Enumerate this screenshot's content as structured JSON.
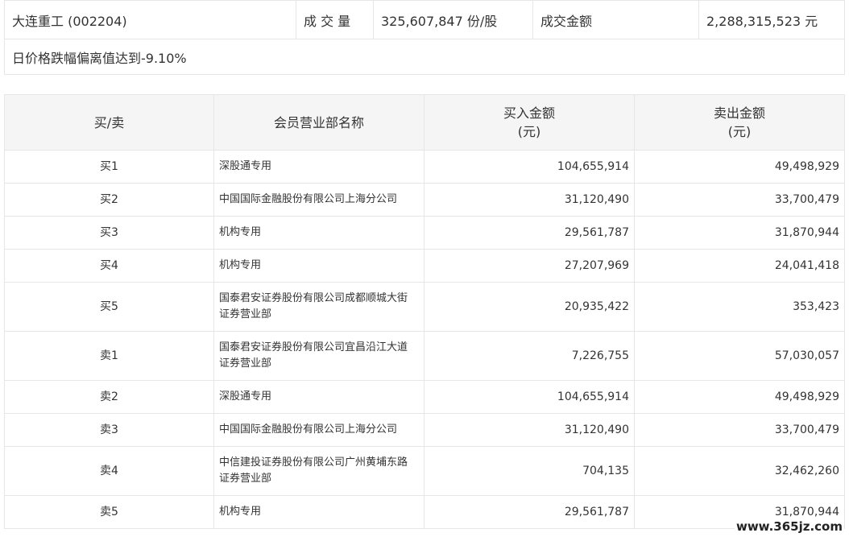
{
  "summary": {
    "stock": "大连重工 (002204)",
    "volume_label": "成 交 量",
    "volume_value": "325,607,847 份/股",
    "amount_label": "成交金额",
    "amount_value": "2,288,315,523 元",
    "note": "日价格跌幅偏离值达到-9.10%"
  },
  "table": {
    "headers": {
      "side": "买/卖",
      "name": "会员营业部名称",
      "buy": "买入金额\n(元)",
      "sell": "卖出金额\n(元)"
    },
    "rows": [
      {
        "side": "买1",
        "name": "深股通专用",
        "buy": "104,655,914",
        "sell": "49,498,929"
      },
      {
        "side": "买2",
        "name": "中国国际金融股份有限公司上海分公司",
        "buy": "31,120,490",
        "sell": "33,700,479"
      },
      {
        "side": "买3",
        "name": "机构专用",
        "buy": "29,561,787",
        "sell": "31,870,944"
      },
      {
        "side": "买4",
        "name": "机构专用",
        "buy": "27,207,969",
        "sell": "24,041,418"
      },
      {
        "side": "买5",
        "name": "国泰君安证券股份有限公司成都顺城大街证券营业部",
        "buy": "20,935,422",
        "sell": "353,423"
      },
      {
        "side": "卖1",
        "name": "国泰君安证券股份有限公司宜昌沿江大道证券营业部",
        "buy": "7,226,755",
        "sell": "57,030,057"
      },
      {
        "side": "卖2",
        "name": "深股通专用",
        "buy": "104,655,914",
        "sell": "49,498,929"
      },
      {
        "side": "卖3",
        "name": "中国国际金融股份有限公司上海分公司",
        "buy": "31,120,490",
        "sell": "33,700,479"
      },
      {
        "side": "卖4",
        "name": "中信建投证券股份有限公司广州黄埔东路证券营业部",
        "buy": "704,135",
        "sell": "32,462,260"
      },
      {
        "side": "卖5",
        "name": "机构专用",
        "buy": "29,561,787",
        "sell": "31,870,944"
      }
    ]
  },
  "watermark": "www.365jz.com"
}
